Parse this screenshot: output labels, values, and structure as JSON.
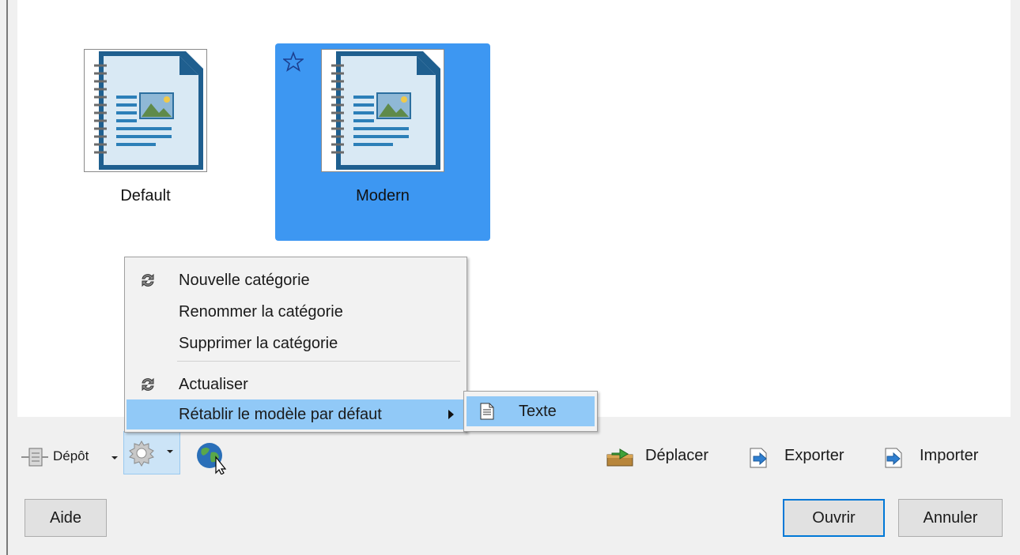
{
  "templates": [
    {
      "name": "Default",
      "selected": false
    },
    {
      "name": "Modern",
      "selected": true
    }
  ],
  "context_menu": {
    "items": [
      {
        "label": "Nouvelle catégorie",
        "icon": "refresh-icon"
      },
      {
        "label": "Renommer la catégorie"
      },
      {
        "label": "Supprimer la catégorie"
      },
      {
        "label": "Actualiser",
        "icon": "refresh-icon"
      },
      {
        "label": "Rétablir le modèle par défaut",
        "submenu": true,
        "highlighted": true
      }
    ],
    "submenu": {
      "items": [
        {
          "label": "Texte",
          "icon": "text-document-icon",
          "highlighted": true
        }
      ]
    }
  },
  "toolbar": {
    "repository_label": "Dépôt",
    "move_label": "Déplacer",
    "export_label": "Exporter",
    "import_label": "Importer"
  },
  "buttons": {
    "help": "Aide",
    "open": "Ouvrir",
    "cancel": "Annuler"
  },
  "colors": {
    "selection": "#3d97f2",
    "menu_highlight": "#91c9f7",
    "default_button_border": "#0078d7"
  }
}
